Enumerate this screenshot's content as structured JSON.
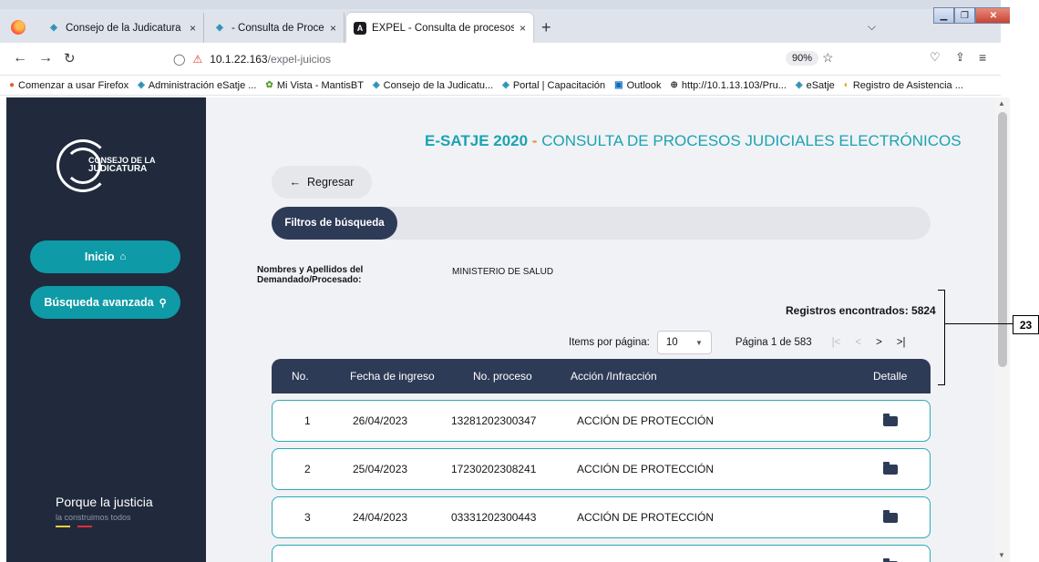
{
  "browser": {
    "tabs": [
      {
        "label": "Consejo de la Judicatura | Cons",
        "icon": "esatje-icon"
      },
      {
        "label": "- Consulta de Procesos - eSATJE",
        "icon": "esatje-icon"
      },
      {
        "label": "EXPEL - Consulta de procesos",
        "icon": "angular-icon",
        "active": true
      }
    ],
    "tab_close": "×",
    "new_tab": "+",
    "url_host": "10.1.22.163",
    "url_path": "/expel-juicios",
    "zoom": "90%",
    "bookmarks": [
      "Comenzar a usar Firefox",
      "Administración eSatje ...",
      "Mi Vista - MantisBT",
      "Consejo de la Judicatu...",
      "Portal | Capacitación",
      "Outlook",
      "http://10.1.13.103/Pru...",
      "eSatje",
      "Registro de Asistencia ..."
    ]
  },
  "sidebar": {
    "logo_line1": "CONSEJO DE LA",
    "logo_line2": "JUDICATURA",
    "nav": [
      {
        "label": "Inicio",
        "icon": "home-icon"
      },
      {
        "label": "Búsqueda avanzada",
        "icon": "search-icon"
      }
    ],
    "slogan": "Porque la justicia",
    "slogan_sub": "la construimos todos"
  },
  "main": {
    "title_bold": "E-SATJE 2020",
    "title_dash": " - ",
    "title_rest": "CONSULTA DE PROCESOS JUDICIALES ELECTRÓNICOS",
    "back_label": "Regresar",
    "filters_label": "Filtros de búsqueda",
    "filter_field_label": "Nombres y Apellidos del Demandado/Procesado:",
    "filter_field_value": "MINISTERIO DE SALUD",
    "records_label": "Registros encontrados: 5824",
    "items_per_page_label": "Items por página:",
    "items_per_page_value": "10",
    "page_info": "Página 1 de 583",
    "table": {
      "headers": [
        "No.",
        "Fecha de ingreso",
        "No. proceso",
        "Acción /Infracción",
        "Detalle"
      ],
      "rows": [
        {
          "no": "1",
          "fecha": "26/04/2023",
          "proceso": "13281202300347",
          "accion": "ACCIÓN DE PROTECCIÓN"
        },
        {
          "no": "2",
          "fecha": "25/04/2023",
          "proceso": "17230202308241",
          "accion": "ACCIÓN DE PROTECCIÓN"
        },
        {
          "no": "3",
          "fecha": "24/04/2023",
          "proceso": "03331202300443",
          "accion": "ACCIÓN DE PROTECCIÓN"
        }
      ]
    }
  },
  "annotation": {
    "label": "23"
  },
  "colors": {
    "sidebar": "#202a3c",
    "accent": "#1aa3b2",
    "header": "#2e3b57",
    "button": "#0f9aa7"
  }
}
